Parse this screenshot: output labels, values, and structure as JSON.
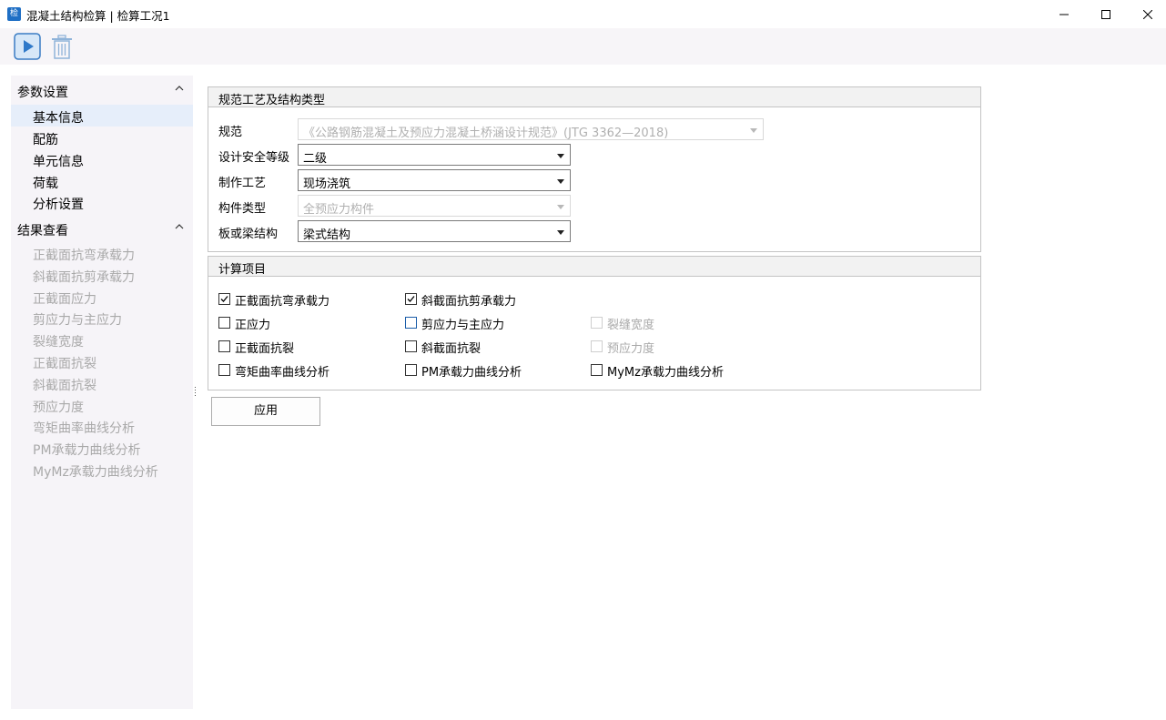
{
  "window": {
    "title": "混凝土结构检算 | 检算工况1",
    "app_icon": "app-icon"
  },
  "toolbar": {
    "run_icon": "play-icon",
    "delete_icon": "trash-icon"
  },
  "sidebar": {
    "groups": [
      {
        "title": "参数设置",
        "items": [
          {
            "label": "基本信息",
            "selected": true,
            "enabled": true
          },
          {
            "label": "配筋",
            "enabled": true
          },
          {
            "label": "单元信息",
            "enabled": true
          },
          {
            "label": "荷载",
            "enabled": true
          },
          {
            "label": "分析设置",
            "enabled": true
          }
        ]
      },
      {
        "title": "结果查看",
        "items": [
          {
            "label": "正截面抗弯承载力",
            "enabled": false
          },
          {
            "label": "斜截面抗剪承载力",
            "enabled": false
          },
          {
            "label": "正截面应力",
            "enabled": false
          },
          {
            "label": "剪应力与主应力",
            "enabled": false
          },
          {
            "label": "裂缝宽度",
            "enabled": false
          },
          {
            "label": "正截面抗裂",
            "enabled": false
          },
          {
            "label": "斜截面抗裂",
            "enabled": false
          },
          {
            "label": "预应力度",
            "enabled": false
          },
          {
            "label": "弯矩曲率曲线分析",
            "enabled": false
          },
          {
            "label": "PM承载力曲线分析",
            "enabled": false
          },
          {
            "label": "MyMz承载力曲线分析",
            "enabled": false
          }
        ]
      }
    ]
  },
  "spec_group": {
    "title": "规范工艺及结构类型",
    "fields": [
      {
        "label": "规范",
        "value": "《公路钢筋混凝土及预应力混凝土桥涵设计规范》(JTG 3362—2018)",
        "enabled": false
      },
      {
        "label": "设计安全等级",
        "value": "二级",
        "enabled": true
      },
      {
        "label": "制作工艺",
        "value": "现场浇筑",
        "enabled": true
      },
      {
        "label": "构件类型",
        "value": "全预应力构件",
        "enabled": false
      },
      {
        "label": "板或梁结构",
        "value": "梁式结构",
        "enabled": true
      }
    ]
  },
  "calc_group": {
    "title": "计算项目",
    "checks": [
      {
        "label": "正截面抗弯承载力",
        "checked": true,
        "enabled": true
      },
      {
        "label": "斜截面抗剪承载力",
        "checked": true,
        "enabled": true
      },
      {
        "label": "正应力",
        "checked": false,
        "enabled": true
      },
      {
        "label": "剪应力与主应力",
        "checked": false,
        "enabled": true
      },
      {
        "label": "裂缝宽度",
        "checked": false,
        "enabled": false
      },
      {
        "label": "正截面抗裂",
        "checked": false,
        "enabled": true
      },
      {
        "label": "斜截面抗裂",
        "checked": false,
        "enabled": true
      },
      {
        "label": "预应力度",
        "checked": false,
        "enabled": false
      },
      {
        "label": "弯矩曲率曲线分析",
        "checked": false,
        "enabled": true
      },
      {
        "label": "PM承载力曲线分析",
        "checked": false,
        "enabled": true
      },
      {
        "label": "MyMz承载力曲线分析",
        "checked": false,
        "enabled": true
      }
    ]
  },
  "apply_button": {
    "label": "应用"
  },
  "colors": {
    "accent": "#1f6fc5",
    "selected_bg": "#e6eefa",
    "disabled_text": "#a9a9a9"
  }
}
